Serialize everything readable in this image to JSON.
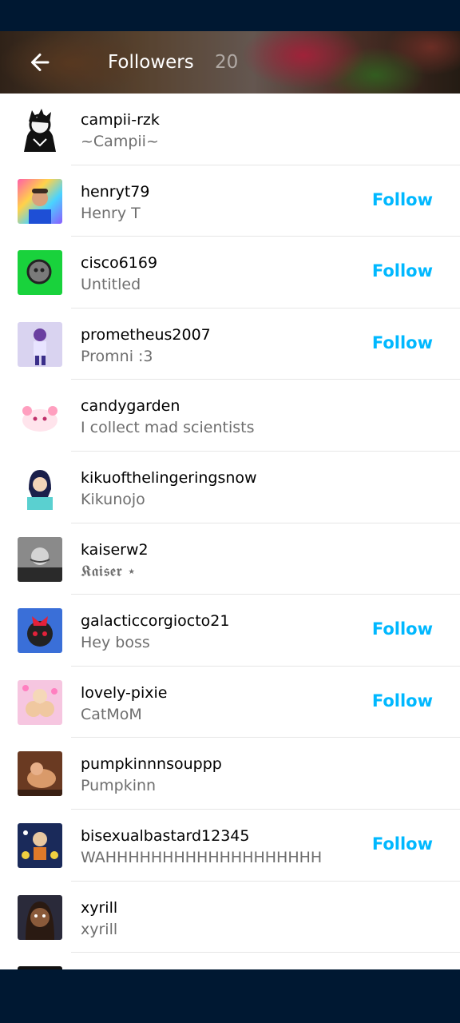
{
  "header": {
    "title": "Followers",
    "count": "20"
  },
  "colors": {
    "accent": "#00b8ff",
    "bar": "#001832"
  },
  "icons": {
    "back": "arrow-left-icon"
  },
  "followers": [
    {
      "username": "campii-rzk",
      "subtitle": "~Campii~",
      "follow": ""
    },
    {
      "username": "henryt79",
      "subtitle": "Henry T",
      "follow": "Follow"
    },
    {
      "username": "cisco6169",
      "subtitle": "Untitled",
      "follow": "Follow"
    },
    {
      "username": "prometheus2007",
      "subtitle": "Promni :3",
      "follow": "Follow"
    },
    {
      "username": "candygarden",
      "subtitle": "I collect mad scientists",
      "follow": ""
    },
    {
      "username": "kikuofthelingeringsnow",
      "subtitle": "Kikunojo",
      "follow": ""
    },
    {
      "username": "kaiserw2",
      "subtitle": "𝕶𝖆𝖎𝖘𝖊𝖗 ⋆",
      "follow": ""
    },
    {
      "username": "galacticcorgiocto21",
      "subtitle": "Hey boss",
      "follow": "Follow"
    },
    {
      "username": "lovely-pixie",
      "subtitle": "CatMoM",
      "follow": "Follow"
    },
    {
      "username": "pumpkinnnsouppp",
      "subtitle": "Pumpkinn",
      "follow": ""
    },
    {
      "username": "bisexualbastard12345",
      "subtitle": "WAHHHHHHHHHHHHHHHHHHH",
      "follow": "Follow"
    },
    {
      "username": "xyrill",
      "subtitle": "xyrill",
      "follow": ""
    }
  ]
}
